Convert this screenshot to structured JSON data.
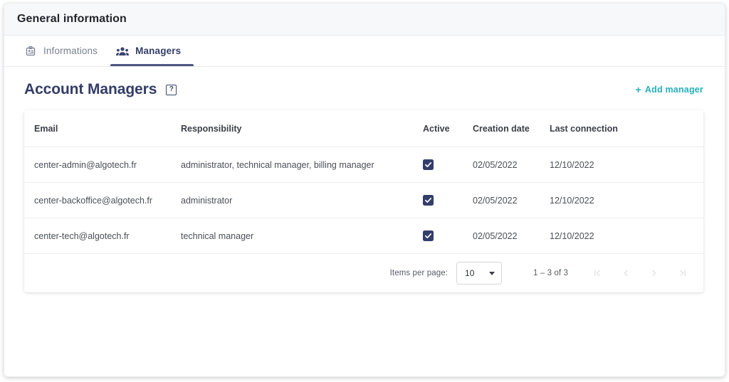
{
  "window": {
    "title": "General information"
  },
  "tabs": [
    {
      "label": "Informations",
      "icon": "id-badge-icon",
      "active": false
    },
    {
      "label": "Managers",
      "icon": "people-group-icon",
      "active": true
    }
  ],
  "section": {
    "title": "Account Managers",
    "help_icon": "help-question-icon",
    "help_glyph": "?",
    "add_button": {
      "plus": "+",
      "label": "Add manager",
      "color": "#23b0bd"
    }
  },
  "table": {
    "columns": [
      "Email",
      "Responsibility",
      "Active",
      "Creation date",
      "Last connection"
    ],
    "rows": [
      {
        "email": "center-admin@algotech.fr",
        "responsibility": "administrator, technical manager, billing manager",
        "active": true,
        "creation_date": "02/05/2022",
        "last_connection": "12/10/2022"
      },
      {
        "email": "center-backoffice@algotech.fr",
        "responsibility": "administrator",
        "active": true,
        "creation_date": "02/05/2022",
        "last_connection": "12/10/2022"
      },
      {
        "email": "center-tech@algotech.fr",
        "responsibility": "technical manager",
        "active": true,
        "creation_date": "02/05/2022",
        "last_connection": "12/10/2022"
      }
    ]
  },
  "paginator": {
    "items_per_page_label": "Items per page:",
    "items_per_page_value": "10",
    "range_label": "1 – 3 of 3",
    "buttons": [
      {
        "name": "first-page-button",
        "glyph": "|<",
        "disabled": true
      },
      {
        "name": "previous-page-button",
        "glyph": "<",
        "disabled": true
      },
      {
        "name": "next-page-button",
        "glyph": ">",
        "disabled": true
      },
      {
        "name": "last-page-button",
        "glyph": ">|",
        "disabled": true
      }
    ]
  },
  "colors": {
    "accent_navy": "#343e6b",
    "accent_teal": "#23b0bd",
    "header_strip": "#f7f8fa",
    "text_primary": "#21252b",
    "text_muted": "#7a8090"
  }
}
